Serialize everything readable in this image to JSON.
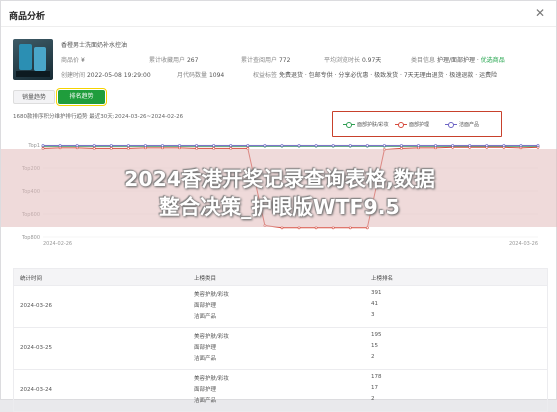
{
  "dialog": {
    "title": "商品分析",
    "close_icon": "close-icon"
  },
  "product": {
    "name": "香橙男士洗面奶补水控油",
    "price_label": "商品价",
    "price": "¥",
    "cum_sales_label": "累计收藏用户",
    "cum_sales": "267",
    "cum_views_label": "累计查阅用户",
    "cum_views": "772",
    "avg_rating_label": "平均浏览时长",
    "avg_rating": "0.97天",
    "category_label": "类目信息",
    "category": "护理/面部护理",
    "status": "优选商品",
    "created_label": "创建时间",
    "created": "2022-05-08 19:29:00",
    "rank_label": "月代码数量",
    "rank": "1094",
    "tags_label": "权益标签",
    "tags": "免费退货 · 包邮专供 · 分享必优惠 · 极致发货 · 7天无理由退货 · 极速退款 · 运费险"
  },
  "tabs": {
    "a": "销量趋势",
    "b": "排名趋势"
  },
  "range": "1680款排序积分维护排行趋势  最近30天:2024-03-26~2024-02-26",
  "legend": [
    {
      "label": "面部护肤/彩妆",
      "color": "#2e9d52"
    },
    {
      "label": "面部护理",
      "color": "#d54b3e"
    },
    {
      "label": "洁面产品",
      "color": "#6d64c4"
    }
  ],
  "chart_data": {
    "type": "line",
    "title": "",
    "xlabel": "",
    "ylabel": "",
    "yticks": [
      "Top1",
      "Top200",
      "Top400",
      "Top600",
      "Top800"
    ],
    "x": [
      "2024-02-26",
      "2024-02-27",
      "2024-02-28",
      "2024-02-29",
      "2024-03-01",
      "2024-03-02",
      "2024-03-03",
      "2024-03-04",
      "2024-03-05",
      "2024-03-06",
      "2024-03-07",
      "2024-03-08",
      "2024-03-09",
      "2024-03-10",
      "2024-03-11",
      "2024-03-12",
      "2024-03-13",
      "2024-03-14",
      "2024-03-15",
      "2024-03-16",
      "2024-03-17",
      "2024-03-18",
      "2024-03-19",
      "2024-03-20",
      "2024-03-21",
      "2024-03-22",
      "2024-03-23",
      "2024-03-24",
      "2024-03-25",
      "2024-03-26"
    ],
    "xticks_shown": [
      "2024-02-26",
      "2024-03-26"
    ],
    "series": [
      {
        "name": "面部护肤/彩妆",
        "color": "#2e9d52",
        "values": [
          10,
          10,
          10,
          10,
          10,
          10,
          10,
          10,
          10,
          10,
          10,
          10,
          10,
          10,
          10,
          10,
          10,
          10,
          10,
          10,
          10,
          10,
          10,
          10,
          10,
          10,
          10,
          10,
          10,
          10
        ]
      },
      {
        "name": "面部护理",
        "color": "#d54b3e",
        "values": [
          30,
          25,
          25,
          30,
          30,
          30,
          25,
          25,
          25,
          30,
          30,
          30,
          30,
          700,
          720,
          720,
          720,
          720,
          720,
          720,
          40,
          30,
          25,
          25,
          20,
          20,
          20,
          20,
          25,
          20
        ]
      },
      {
        "name": "洁面产品",
        "color": "#6d64c4",
        "values": [
          5,
          5,
          5,
          5,
          5,
          5,
          5,
          5,
          5,
          5,
          5,
          5,
          5,
          5,
          5,
          5,
          5,
          5,
          5,
          5,
          5,
          5,
          5,
          5,
          5,
          5,
          5,
          5,
          5,
          5
        ]
      }
    ]
  },
  "watermark": {
    "line1": "2024香港开奖记录查询表格,数据",
    "line2": "整合决策_护眼版WTF9.5"
  },
  "table": {
    "headers": [
      "统计时间",
      "上榜类目",
      "上榜排名"
    ],
    "groups": [
      {
        "date": "2024-03-26",
        "rows": [
          {
            "name": "美容护肤/彩妆",
            "rank": "391"
          },
          {
            "name": "面部护理",
            "rank": "41"
          },
          {
            "name": "洁面产品",
            "rank": "3"
          }
        ]
      },
      {
        "date": "2024-03-25",
        "rows": [
          {
            "name": "美容护肤/彩妆",
            "rank": "195"
          },
          {
            "name": "面部护理",
            "rank": "15"
          },
          {
            "name": "洁面产品",
            "rank": "2"
          }
        ]
      },
      {
        "date": "2024-03-24",
        "rows": [
          {
            "name": "美容护肤/彩妆",
            "rank": "178"
          },
          {
            "name": "面部护理",
            "rank": "17"
          },
          {
            "name": "洁面产品",
            "rank": "2"
          }
        ]
      }
    ]
  }
}
